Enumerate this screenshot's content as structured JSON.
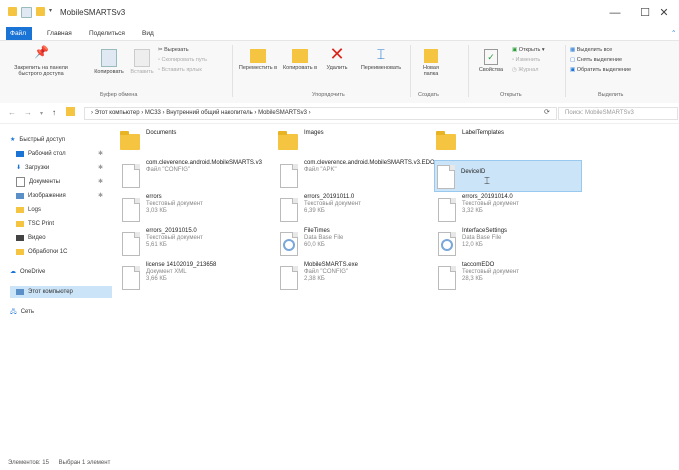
{
  "window": {
    "title": "MobileSMARTSv3",
    "minimize": "—",
    "maximize": "☐",
    "close": "✕"
  },
  "tabs": {
    "file": "Файл",
    "home": "Главная",
    "share": "Поделиться",
    "view": "Вид"
  },
  "ribbon": {
    "pin": "Закрепить на панели быстрого доступа",
    "copy": "Копировать",
    "paste": "Вставить",
    "cut": "Вырезать",
    "copy_path": "Скопировать путь",
    "paste_shortcut": "Вставить ярлык",
    "clipboard_label": "Буфер обмена",
    "move_to": "Переместить в",
    "copy_to": "Копировать в",
    "delete": "Удалить",
    "rename": "Переименовать",
    "organize_label": "Упорядочить",
    "new_folder": "Новая папка",
    "create_label": "Создать",
    "properties": "Свойства",
    "open": "Открыть",
    "edit": "Изменить",
    "history": "Журнал",
    "open_label": "Открыть",
    "select_all": "Выделить все",
    "select_none": "Снять выделение",
    "invert": "Обратить выделение",
    "select_label": "Выделить"
  },
  "address": {
    "back": "←",
    "forward": "→",
    "up": "↑",
    "path": "›  Этот компьютер  ›  MC33  ›  Внутренний общий накопитель  ›  MobileSMARTSv3  ›",
    "refresh": "⟳",
    "search_placeholder": "Поиск: MobileSMARTSv3"
  },
  "sidebar": {
    "quick_access": "Быстрый доступ",
    "desktop": "Рабочий стол",
    "downloads": "Загрузки",
    "documents": "Документы",
    "pictures": "Изображения",
    "logs": "Logs",
    "tsc_print": "TSC Print",
    "videos": "Видео",
    "processing": "Обработки 1С",
    "onedrive": "OneDrive",
    "this_pc": "Этот компьютер",
    "network": "Сеть"
  },
  "files": [
    {
      "name": "Documents",
      "meta1": "",
      "meta2": ""
    },
    {
      "name": "Images",
      "meta1": "",
      "meta2": ""
    },
    {
      "name": "LabelTemplates",
      "meta1": "",
      "meta2": ""
    },
    {
      "name": "com.cleverence.android.MobileSMARTS.v3",
      "meta1": "Файл \"CONFIG\"",
      "meta2": ""
    },
    {
      "name": "com.cleverence.android.MobileSMARTS.v3.EDO",
      "meta1": "Файл \"APK\"",
      "meta2": ""
    },
    {
      "name": "DeviceID",
      "meta1": "",
      "meta2": ""
    },
    {
      "name": "errors",
      "meta1": "Текстовый документ",
      "meta2": "3,03 КБ"
    },
    {
      "name": "errors_20191011.0",
      "meta1": "Текстовый документ",
      "meta2": "6,39 КБ"
    },
    {
      "name": "errors_20191014.0",
      "meta1": "Текстовый документ",
      "meta2": "3,32 КБ"
    },
    {
      "name": "errors_20191015.0",
      "meta1": "Текстовый документ",
      "meta2": "5,61 КБ"
    },
    {
      "name": "FileTimes",
      "meta1": "Data Base File",
      "meta2": "60,0 КБ"
    },
    {
      "name": "InterfaceSettings",
      "meta1": "Data Base File",
      "meta2": "12,0 КБ"
    },
    {
      "name": "license 14102019_213658",
      "meta1": "Документ XML",
      "meta2": "3,66 КБ"
    },
    {
      "name": "MobileSMARTS.exe",
      "meta1": "Файл \"CONFIG\"",
      "meta2": "2,38 КБ"
    },
    {
      "name": "taccomEDO",
      "meta1": "Текстовый документ",
      "meta2": "28,3 КБ"
    }
  ],
  "status": {
    "count": "Элементов: 15",
    "selected": "Выбран 1 элемент"
  },
  "colors": {
    "accent": "#1a74d6",
    "folder": "#f5c542",
    "selection": "#cce4f7"
  }
}
